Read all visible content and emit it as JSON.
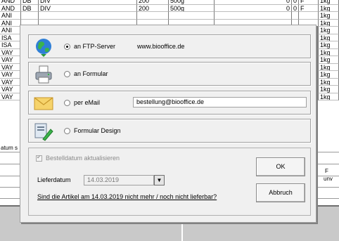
{
  "background_table": {
    "rows": [
      [
        "AND",
        "DB",
        "DIV",
        "200",
        "500g",
        "0",
        "0",
        "F",
        "1kg"
      ],
      [
        "AND",
        "DB",
        "DIV",
        "200",
        "500g",
        "0",
        "0",
        "F",
        "1kg"
      ],
      [
        "ANI",
        "",
        "",
        "",
        "",
        "",
        "",
        "",
        "1kg"
      ],
      [
        "ANI",
        "",
        "",
        "",
        "",
        "",
        "",
        "",
        "1kg"
      ],
      [
        "ANI",
        "",
        "",
        "",
        "",
        "",
        "",
        "",
        "1kg"
      ],
      [
        "ISA",
        "",
        "",
        "",
        "",
        "",
        "",
        "",
        "1kg"
      ],
      [
        "ISA",
        "",
        "",
        "",
        "",
        "",
        "",
        "",
        "1kg"
      ],
      [
        "VAY",
        "",
        "",
        "",
        "",
        "",
        "",
        "",
        "1kg"
      ],
      [
        "VAY",
        "",
        "",
        "",
        "",
        "",
        "",
        "",
        "1kg"
      ],
      [
        "VAY",
        "",
        "",
        "",
        "",
        "",
        "",
        "",
        "1kg"
      ],
      [
        "VAY",
        "",
        "",
        "",
        "",
        "",
        "",
        "",
        "1kg"
      ],
      [
        "VAY",
        "",
        "",
        "",
        "",
        "",
        "",
        "",
        "1kg"
      ],
      [
        "VAY",
        "",
        "",
        "",
        "",
        "",
        "",
        "",
        "1kg"
      ],
      [
        "VAY",
        "",
        "",
        "",
        "",
        "",
        "",
        "",
        "1kg"
      ]
    ],
    "datum_fragment": "atum s",
    "f_fragment": "F",
    "unv_fragment": "unv"
  },
  "dialog": {
    "options": [
      {
        "label": "an FTP-Server",
        "value": "www.biooffice.de",
        "icon": "globe-icon",
        "selected": true
      },
      {
        "label": "an Formular",
        "value": "",
        "icon": "printer-icon",
        "selected": false
      },
      {
        "label": "per eMail",
        "value": "bestellung@biooffice.de",
        "icon": "envelope-icon",
        "selected": false
      },
      {
        "label": "Formular Design",
        "value": "",
        "icon": "design-tool-icon",
        "selected": false
      }
    ],
    "checkbox_label": "Bestelldatum aktualisieren",
    "date_label": "Lieferdatum",
    "date_value": "14.03.2019",
    "question_link": "Sind die Artikel am 14.03.2019 nicht mehr / noch nicht lieferbar?",
    "ok_label": "OK",
    "cancel_label": "Abbruch"
  }
}
